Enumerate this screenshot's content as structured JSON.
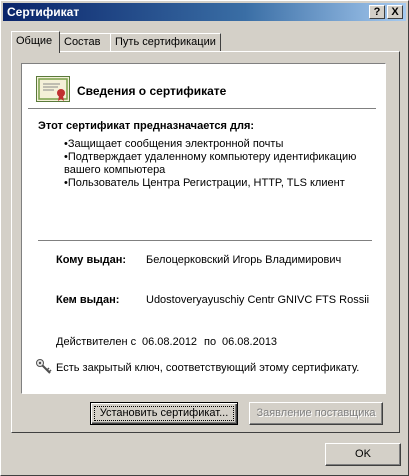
{
  "window": {
    "title": "Сертификат",
    "help_glyph": "?",
    "close_glyph": "X"
  },
  "tabs": [
    {
      "label": "Общие"
    },
    {
      "label": "Состав"
    },
    {
      "label": "Путь сертификации"
    }
  ],
  "cert": {
    "heading": "Сведения о сертификате",
    "purpose_title": "Этот сертификат предназначается для:",
    "purposes": [
      "•Защищает сообщения электронной почты",
      "•Подтверждает удаленному компьютеру идентификацию",
      "вашего компьютера",
      "•Пользователь Центра Регистрации, HTTP, TLS клиент"
    ],
    "issued_to_label": "Кому выдан:",
    "issued_to_value": "Белоцерковский Игорь Владимирович",
    "issued_by_label": "Кем выдан:",
    "issued_by_value": "Udostoveryayuschiy Centr GNIVC FTS Rossii",
    "valid_from_label": "Действителен с",
    "valid_from": "06.08.2012",
    "valid_to_label": "по",
    "valid_to": "06.08.2013",
    "private_key_note": "Есть закрытый ключ, соответствующий этому сертификату."
  },
  "buttons": {
    "install": "Установить сертификат...",
    "issuer_statement": "Заявление поставщика",
    "ok": "OK"
  }
}
